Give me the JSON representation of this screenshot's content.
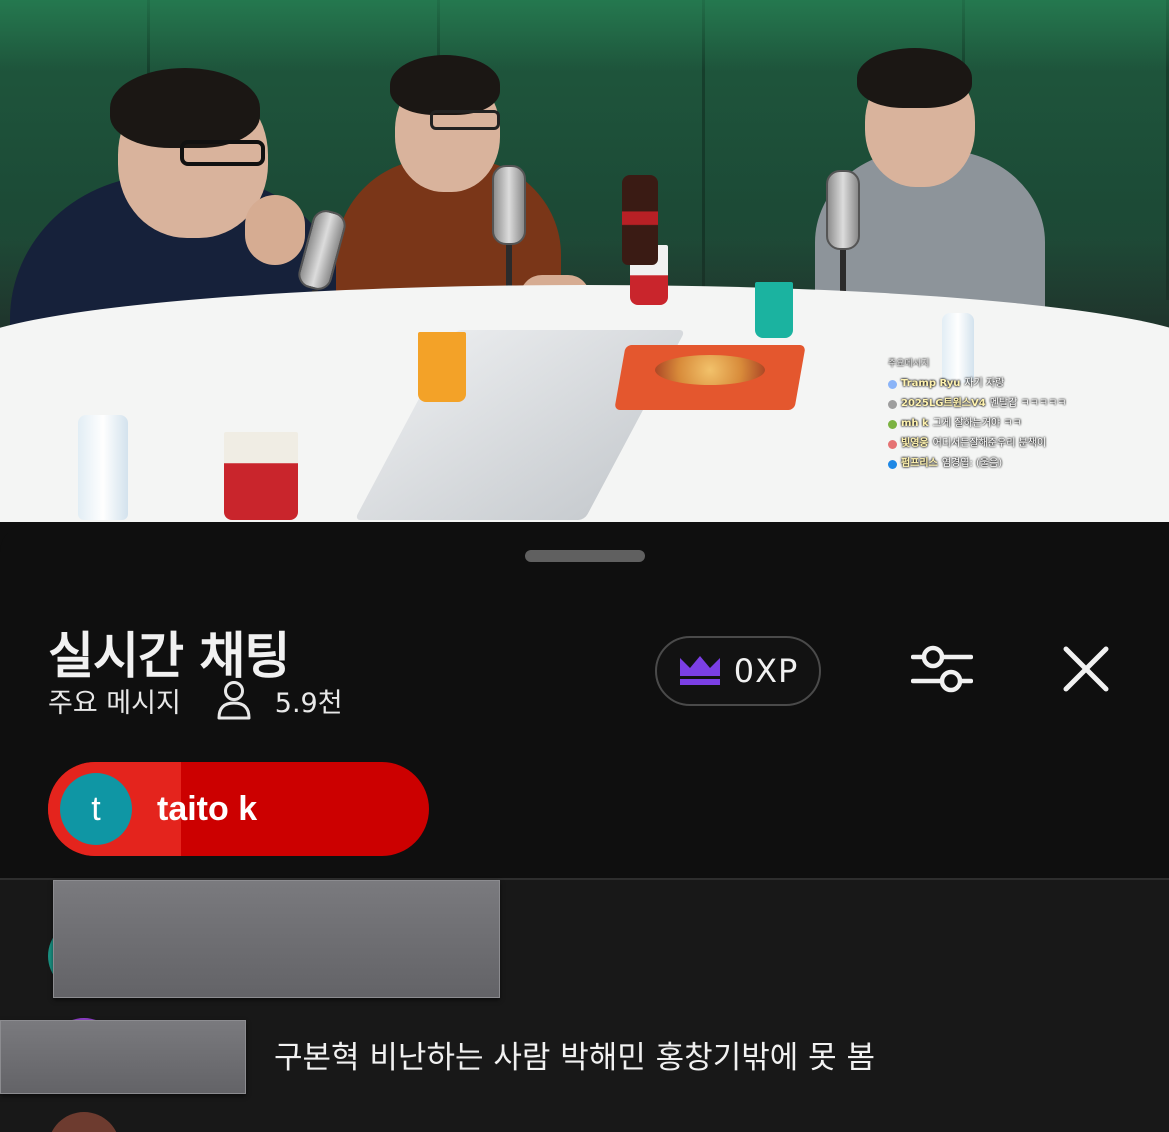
{
  "video": {
    "overlay_chat": {
      "header": "주요메시지",
      "lines": [
        {
          "author": "Tramp Ryu",
          "text": "자기 자랑",
          "color": "#8ab4f8"
        },
        {
          "author": "2025LG트윈스V4",
          "text": "멘탈갑 ㅋㅋㅋㅋㅋ",
          "color": "#9e9e9e"
        },
        {
          "author": "mh k",
          "text": "그게 잘하는거야 ㅋㅋ",
          "color": "#7cb342"
        },
        {
          "author": "빛영웅",
          "text": "어디서든잘해준우리 분책이",
          "color": "#e57373"
        },
        {
          "author": "펌프리스",
          "text": "염경엽: (울음)",
          "color": "#1e88e5"
        }
      ]
    }
  },
  "chat": {
    "title": "실시간 채팅",
    "mode": "주요 메시지",
    "viewer_icon": "person-icon",
    "viewer_count": "5.9천",
    "xp_icon": "crown-icon",
    "xp_label": "0XP",
    "settings_icon": "sliders-icon",
    "close_icon": "close-icon",
    "pinned": {
      "avatar_letter": "t",
      "name": "taito k",
      "progress": 0.35
    },
    "messages": [
      {
        "text": "구본혁 비난하는 사람 박해민 홍창기밖에 못 봄"
      }
    ]
  },
  "colors": {
    "background": "#0f0f0f",
    "chat_area": "#181818",
    "pinned_red": "#cc0000",
    "pinned_fill": "#e4241d",
    "avatar_teal": "#0f96a4",
    "crown_purple": "#7b3fe4"
  }
}
